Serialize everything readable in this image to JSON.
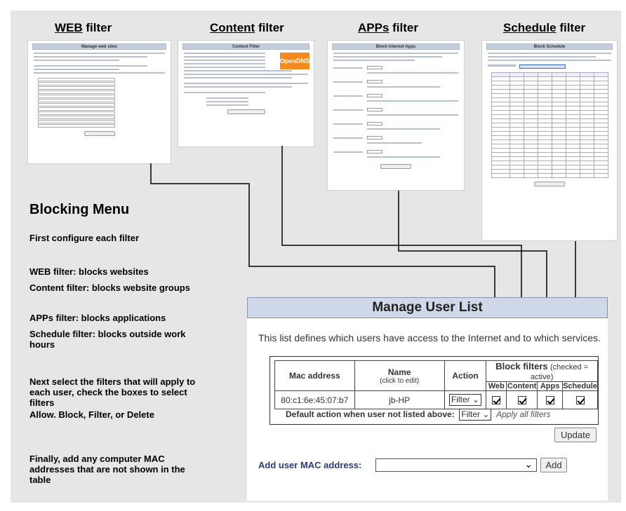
{
  "filters": [
    {
      "title_u": "WEB",
      "title_rest": " filter",
      "screen_title": "Manage web sites"
    },
    {
      "title_u": "Content",
      "title_rest": " filter",
      "screen_title": "Content Filter",
      "logo": "OpenDNS"
    },
    {
      "title_u": "APPs",
      "title_rest": " filter",
      "screen_title": "Block Internet Apps"
    },
    {
      "title_u": "Schedule",
      "title_rest": " filter",
      "screen_title": "Block Schedule"
    }
  ],
  "left": {
    "heading": "Blocking Menu",
    "first": "First configure each filter",
    "items": [
      "WEB filter: blocks websites",
      "Content filter: blocks website groups",
      "APPs filter: blocks applications",
      "Schedule filter: blocks outside work hours"
    ],
    "next": "Next select the filters that will apply to each user, check the boxes to select filters",
    "allow": "Allow. Block, Filter, or Delete",
    "finally": "Finally, add any computer MAC addresses that are not shown in the table"
  },
  "manage": {
    "title": "Manage User List",
    "description": "This list defines which users have access to the Internet and to which services.",
    "columns": {
      "mac": "Mac address",
      "name": "Name",
      "name_hint": "(click to edit)",
      "action": "Action",
      "block_filters": "Block filters",
      "block_hint": "(checked = active)",
      "web": "Web",
      "content": "Content",
      "apps": "Apps",
      "schedule": "Schedule"
    },
    "row": {
      "mac": "80:c1:6e:45:07:b7",
      "name": "jb-HP",
      "action": "Filter"
    },
    "default_label": "Default action when user not listed above:",
    "default_value": "Filter",
    "default_note": "Apply all filters",
    "update": "Update",
    "add_label": "Add user MAC address:",
    "add_button": "Add"
  }
}
